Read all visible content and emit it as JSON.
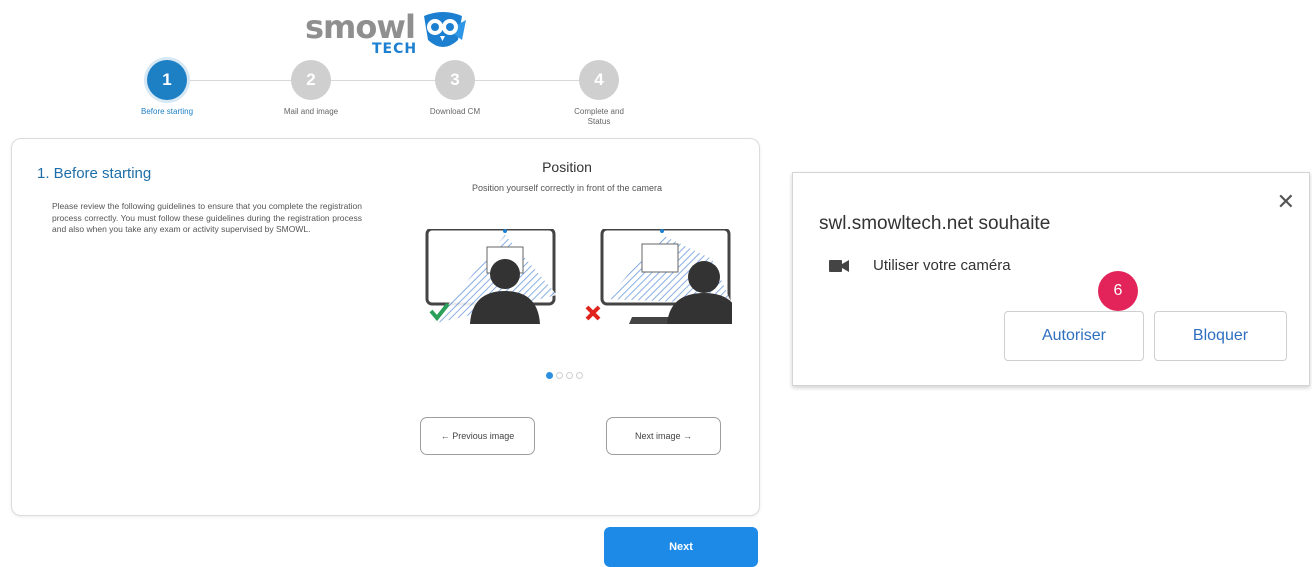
{
  "logo": {
    "word": "smowl",
    "sub": "TECH"
  },
  "stepper": {
    "steps": [
      {
        "number": "1",
        "label": "Before starting"
      },
      {
        "number": "2",
        "label": "Mail and image"
      },
      {
        "number": "3",
        "label": "Download CM"
      },
      {
        "number": "4",
        "label": "Complete and Status"
      }
    ],
    "active_step": 1
  },
  "card": {
    "title": "1. Before starting",
    "description": "Please review the following guidelines to ensure that you complete the registration process correctly. You must follow these guidelines during the registration process and also when you take any exam or activity supervised by SMOWL.",
    "position_title": "Position",
    "position_subtitle": "Position yourself correctly in front of the camera",
    "carousel": {
      "total": 4,
      "current": 1
    },
    "prev_label": "← Previous image",
    "next_label": "Next image →"
  },
  "next_button": "Next",
  "colors": {
    "accent": "#1d8ae8",
    "badge": "#e3245a",
    "ok": "#2aa05a",
    "bad": "#e0231b"
  },
  "permission_popup": {
    "title": "swl.smowltech.net souhaite",
    "permission": "Utiliser votre caméra",
    "allow": "Autoriser",
    "block": "Bloquer",
    "badge": "6"
  }
}
